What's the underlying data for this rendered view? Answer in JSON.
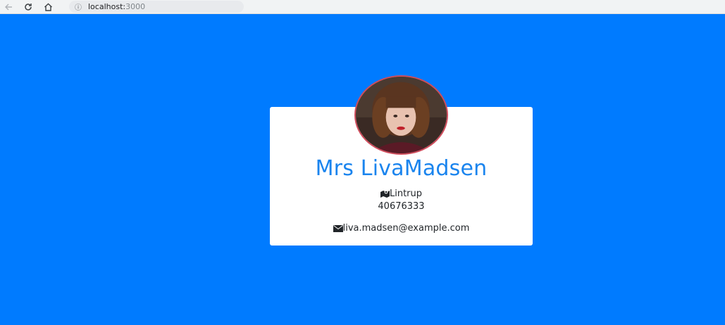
{
  "browser": {
    "back_icon": "arrow-left-icon",
    "reload_icon": "reload-icon",
    "home_icon": "home-icon",
    "url_host": "localhost:",
    "url_port": "3000"
  },
  "profile": {
    "name": "Mrs LivaMadsen",
    "location": "Lintrup",
    "phone": "40676333",
    "email": "liva.madsen@example.com",
    "avatar": "profile-photo"
  },
  "colors": {
    "background": "#007bff",
    "name": "#1a84ee",
    "avatar_border": "#d04c5c"
  }
}
